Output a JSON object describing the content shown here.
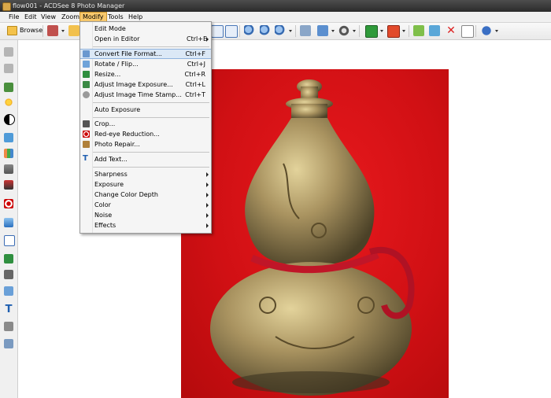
{
  "window": {
    "title": "flow001 - ACDSee 8 Photo Manager"
  },
  "menubar": {
    "items": [
      {
        "label": "File"
      },
      {
        "label": "Edit"
      },
      {
        "label": "View"
      },
      {
        "label": "Zoom"
      },
      {
        "label": "Modify"
      },
      {
        "label": "Tools"
      },
      {
        "label": "Help"
      }
    ],
    "active": "Modify"
  },
  "toolbar": {
    "browse_label": "Browse"
  },
  "modify_menu": {
    "items": [
      {
        "label": "Edit Mode",
        "shortcut": ""
      },
      {
        "label": "Open in Editor",
        "shortcut": "Ctrl+E"
      },
      {
        "label": "Convert File Format...",
        "shortcut": "Ctrl+F"
      },
      {
        "label": "Rotate / Flip...",
        "shortcut": "Ctrl+J"
      },
      {
        "label": "Resize...",
        "shortcut": "Ctrl+R"
      },
      {
        "label": "Adjust Image Exposure...",
        "shortcut": "Ctrl+L"
      },
      {
        "label": "Adjust Image Time Stamp...",
        "shortcut": "Ctrl+T"
      },
      {
        "label": "Auto Exposure",
        "shortcut": ""
      },
      {
        "label": "Crop...",
        "shortcut": ""
      },
      {
        "label": "Red-eye Reduction...",
        "shortcut": ""
      },
      {
        "label": "Photo Repair...",
        "shortcut": ""
      },
      {
        "label": "Add Text...",
        "shortcut": ""
      },
      {
        "label": "Sharpness",
        "shortcut": ""
      },
      {
        "label": "Exposure",
        "shortcut": ""
      },
      {
        "label": "Change Color Depth",
        "shortcut": ""
      },
      {
        "label": "Color",
        "shortcut": ""
      },
      {
        "label": "Noise",
        "shortcut": ""
      },
      {
        "label": "Effects",
        "shortcut": ""
      }
    ],
    "highlighted": "Convert File Format..."
  },
  "image": {
    "subject": "brass gourd-shaped bottle with red cord on red background"
  },
  "colors": {
    "highlight": "#dbe8f6",
    "menu_active": "#f7c86c",
    "photo_background": "#d11014"
  }
}
